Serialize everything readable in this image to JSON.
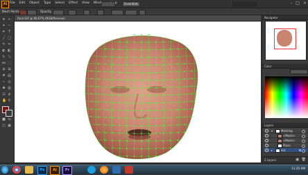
{
  "app": {
    "logo": "Ai",
    "title_doc": "Face.GIF @ 66.67% (RGB/Preview)"
  },
  "menu": [
    "File",
    "Edit",
    "Object",
    "Type",
    "Select",
    "Effect",
    "View",
    "Window",
    "Help"
  ],
  "workspace": {
    "label": "Essentials",
    "search_placeholder": ""
  },
  "control_bar": {
    "mesh_label": "Mesh Points",
    "opacity_label": "Opacity",
    "opacity_value": "100%",
    "style_label": "Style"
  },
  "navigator": {
    "tab_label": "Navigator"
  },
  "color_panel": {
    "tab_label": "Color",
    "tab2": "Color Guide"
  },
  "layers": {
    "tab_label": "Layers",
    "rows": [
      {
        "name": "Meshing"
      },
      {
        "name": "<Mesh>"
      },
      {
        "name": "<Mesh>"
      },
      {
        "name": "Place"
      },
      {
        "name": "dot"
      }
    ],
    "footer": "2 Layers"
  },
  "taskbar": {
    "apps": [
      {
        "icon": "start-orb-icon",
        "label": ""
      },
      {
        "icon": "chrome-icon",
        "label": ""
      },
      {
        "icon": "explorer-icon",
        "label": ""
      },
      {
        "icon": "photoshop-icon",
        "label": "Ps"
      },
      {
        "icon": "illustrator-icon",
        "label": "Ai"
      },
      {
        "icon": "premiere-icon",
        "label": "Pr"
      },
      {
        "icon": "messenger-icon",
        "label": ""
      },
      {
        "icon": "firefox-icon",
        "label": ""
      },
      {
        "icon": "player-icon",
        "label": ""
      },
      {
        "icon": "paint-icon",
        "label": ""
      }
    ],
    "clock_time": "11:25 AM",
    "clock_date": ""
  },
  "colors": {
    "accent": "#ff9a00",
    "mesh": "#3aff3a",
    "selection": "#6fa8ff"
  }
}
